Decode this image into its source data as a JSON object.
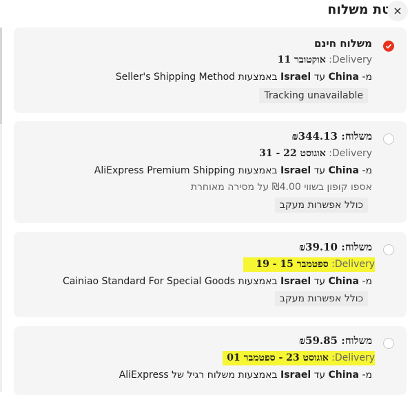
{
  "header": {
    "title": "שיטת משלוח",
    "close_icon": "×"
  },
  "options": [
    {
      "price": "משלוח חינם",
      "delivery_label": "Delivery:",
      "delivery_date": "אוקטובר 11",
      "from_label": "מ-",
      "from": "China",
      "to_label": "עד",
      "to": "Israel",
      "method_prefix": "באמצעות",
      "method": "Seller's Shipping Method",
      "tag": "Tracking unavailable",
      "selected": true
    },
    {
      "price": "משלוח: ₪344.13",
      "delivery_label": "Delivery:",
      "delivery_date": "אוגוסט 22 - 31",
      "from_label": "מ-",
      "from": "China",
      "to_label": "עד",
      "to": "Israel",
      "method_prefix": "באמצעות",
      "method": "AliExpress Premium Shipping",
      "coupon": "אספו קופון בשווי ₪4.00 על מסירה מאוחרת",
      "tag": "כולל אפשרות מעקב",
      "selected": false
    },
    {
      "price": "משלוח: ₪39.10",
      "delivery_label": "Delivery:",
      "delivery_date": "ספטמבר 15 - 19",
      "from_label": "מ-",
      "from": "China",
      "to_label": "עד",
      "to": "Israel",
      "method_prefix": "באמצעות",
      "method": "Cainiao Standard For Special Goods",
      "tag": "כולל אפשרות מעקב",
      "selected": false
    },
    {
      "price": "משלוח: ₪59.85",
      "delivery_label": "Delivery:",
      "delivery_date": "אוגוסט 23 - ספטמבר 01",
      "from_label": "מ-",
      "from": "China",
      "to_label": "עד",
      "to": "Israel",
      "method_prefix": "באמצעות",
      "method": "משלוח רגיל של AliExpress",
      "selected": false
    }
  ],
  "colors": {
    "accent": "#e8321e",
    "highlight": "#f6f632",
    "card_bg": "#f5f5f5"
  }
}
